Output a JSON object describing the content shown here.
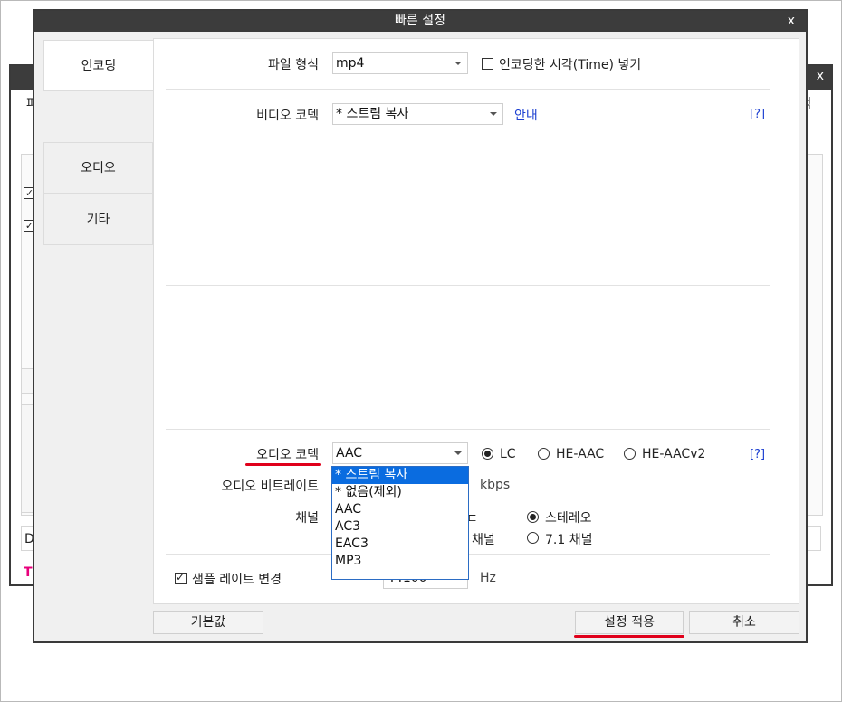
{
  "background_window": {
    "left_glyph": "파",
    "right_glyph": "색",
    "bottom_left_glyph": "D",
    "bottom_marker": "T",
    "close_glyph": "x"
  },
  "dialog": {
    "title": "빠른 설정",
    "close_glyph": "x"
  },
  "sidebar": {
    "tabs": [
      {
        "label": "인코딩",
        "active": true
      },
      {
        "label": "오디오",
        "active": false
      },
      {
        "label": "기타",
        "active": false
      }
    ]
  },
  "file_format": {
    "label": "파일 형식",
    "value": "mp4",
    "timestamp_checkbox_label": "인코딩한 시각(Time) 넣기",
    "timestamp_checked": false
  },
  "video_codec": {
    "label": "비디오 코덱",
    "value": "* 스트림 복사",
    "guide_link": "안내",
    "help": "[?]"
  },
  "audio_codec": {
    "label": "오디오 코덱",
    "value": "AAC",
    "help": "[?]",
    "profiles": [
      {
        "label": "LC",
        "checked": true
      },
      {
        "label": "HE-AAC",
        "checked": false
      },
      {
        "label": "HE-AACv2",
        "checked": false
      }
    ],
    "dropdown_options": [
      "* 스트림 복사",
      "* 없음(제외)",
      "AAC",
      "AC3",
      "EAC3",
      "MP3"
    ],
    "dropdown_selected_index": 0
  },
  "audio_bitrate": {
    "label": "오디오 비트레이트",
    "unit": "kbps"
  },
  "channel": {
    "label": "채널",
    "partial_text_1": "ㄷ",
    "partial_text_2": "채널",
    "options": [
      {
        "label": "스테레오",
        "checked": true
      },
      {
        "label": "7.1 채널",
        "checked": false
      }
    ]
  },
  "sample_rate": {
    "checkbox_label": "샘플 레이트 변경",
    "checked": true,
    "value": "44100",
    "unit": "Hz"
  },
  "buttons": {
    "default": "기본값",
    "apply": "설정 적용",
    "cancel": "취소"
  },
  "colors": {
    "titlebar": "#3c3c3c",
    "highlight": "#e0001b",
    "link": "#1c3fd1",
    "selection": "#0a6ce0"
  }
}
